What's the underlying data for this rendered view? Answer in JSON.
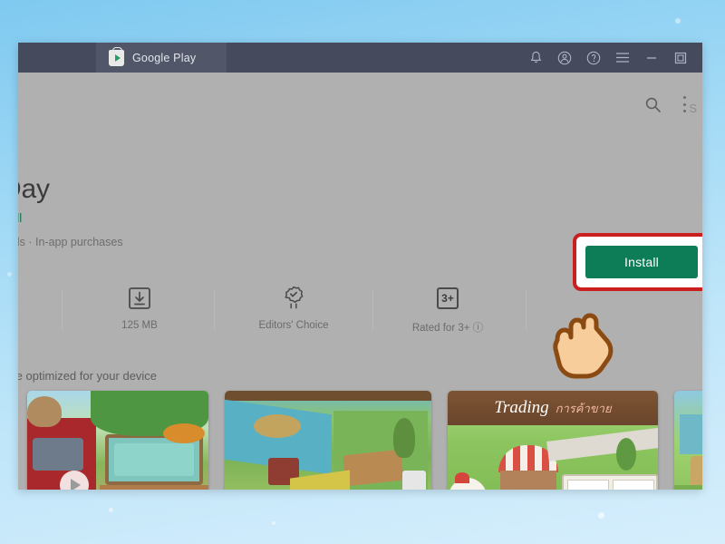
{
  "window": {
    "titlebar": {
      "tab_label": "Google Play",
      "tab_icon": "google-play-bag-icon",
      "controls": [
        {
          "name": "notifications-icon",
          "label": "bell"
        },
        {
          "name": "account-icon",
          "label": "account"
        },
        {
          "name": "help-icon",
          "label": "help"
        },
        {
          "name": "menu-icon",
          "label": "hamburger menu"
        },
        {
          "name": "minimize-button",
          "label": "minimize"
        },
        {
          "name": "maximize-button",
          "label": "maximize"
        }
      ]
    },
    "topbar": {
      "search_icon": "search-icon",
      "overflow_icon": "kebab-menu-icon",
      "corner_text": "S"
    },
    "app": {
      "title": "Day",
      "developer": "cell",
      "meta": "s ads · In-app purchases",
      "install_label": "Install",
      "notice": "ot be optimized for your device"
    },
    "stats": [
      {
        "icon": "download-icon",
        "label": "125 MB"
      },
      {
        "icon": "editors-choice-award-icon",
        "label": "Editors' Choice"
      },
      {
        "icon": "age-rating-3plus-icon",
        "label": "Rated for 3+ ⓘ"
      }
    ],
    "screenshots": [
      {
        "name": "screenshot-video-thumbnail",
        "caption": "",
        "has_play": true
      },
      {
        "name": "screenshot-farm-overview",
        "caption": "",
        "has_play": false
      },
      {
        "name": "screenshot-trading",
        "caption_en": "Trading",
        "caption_local": "การค้าขาย",
        "has_play": false
      },
      {
        "name": "screenshot-partial",
        "caption": "",
        "has_play": false
      }
    ]
  },
  "colors": {
    "titlebar": "#454a5c",
    "tab_active": "#515668",
    "page_bg": "#b0b0b0",
    "install_green": "#0c7d56",
    "highlight_red": "#c9201f",
    "developer_green": "#0f7a56",
    "desktop_blue": "#9ed8f5"
  }
}
